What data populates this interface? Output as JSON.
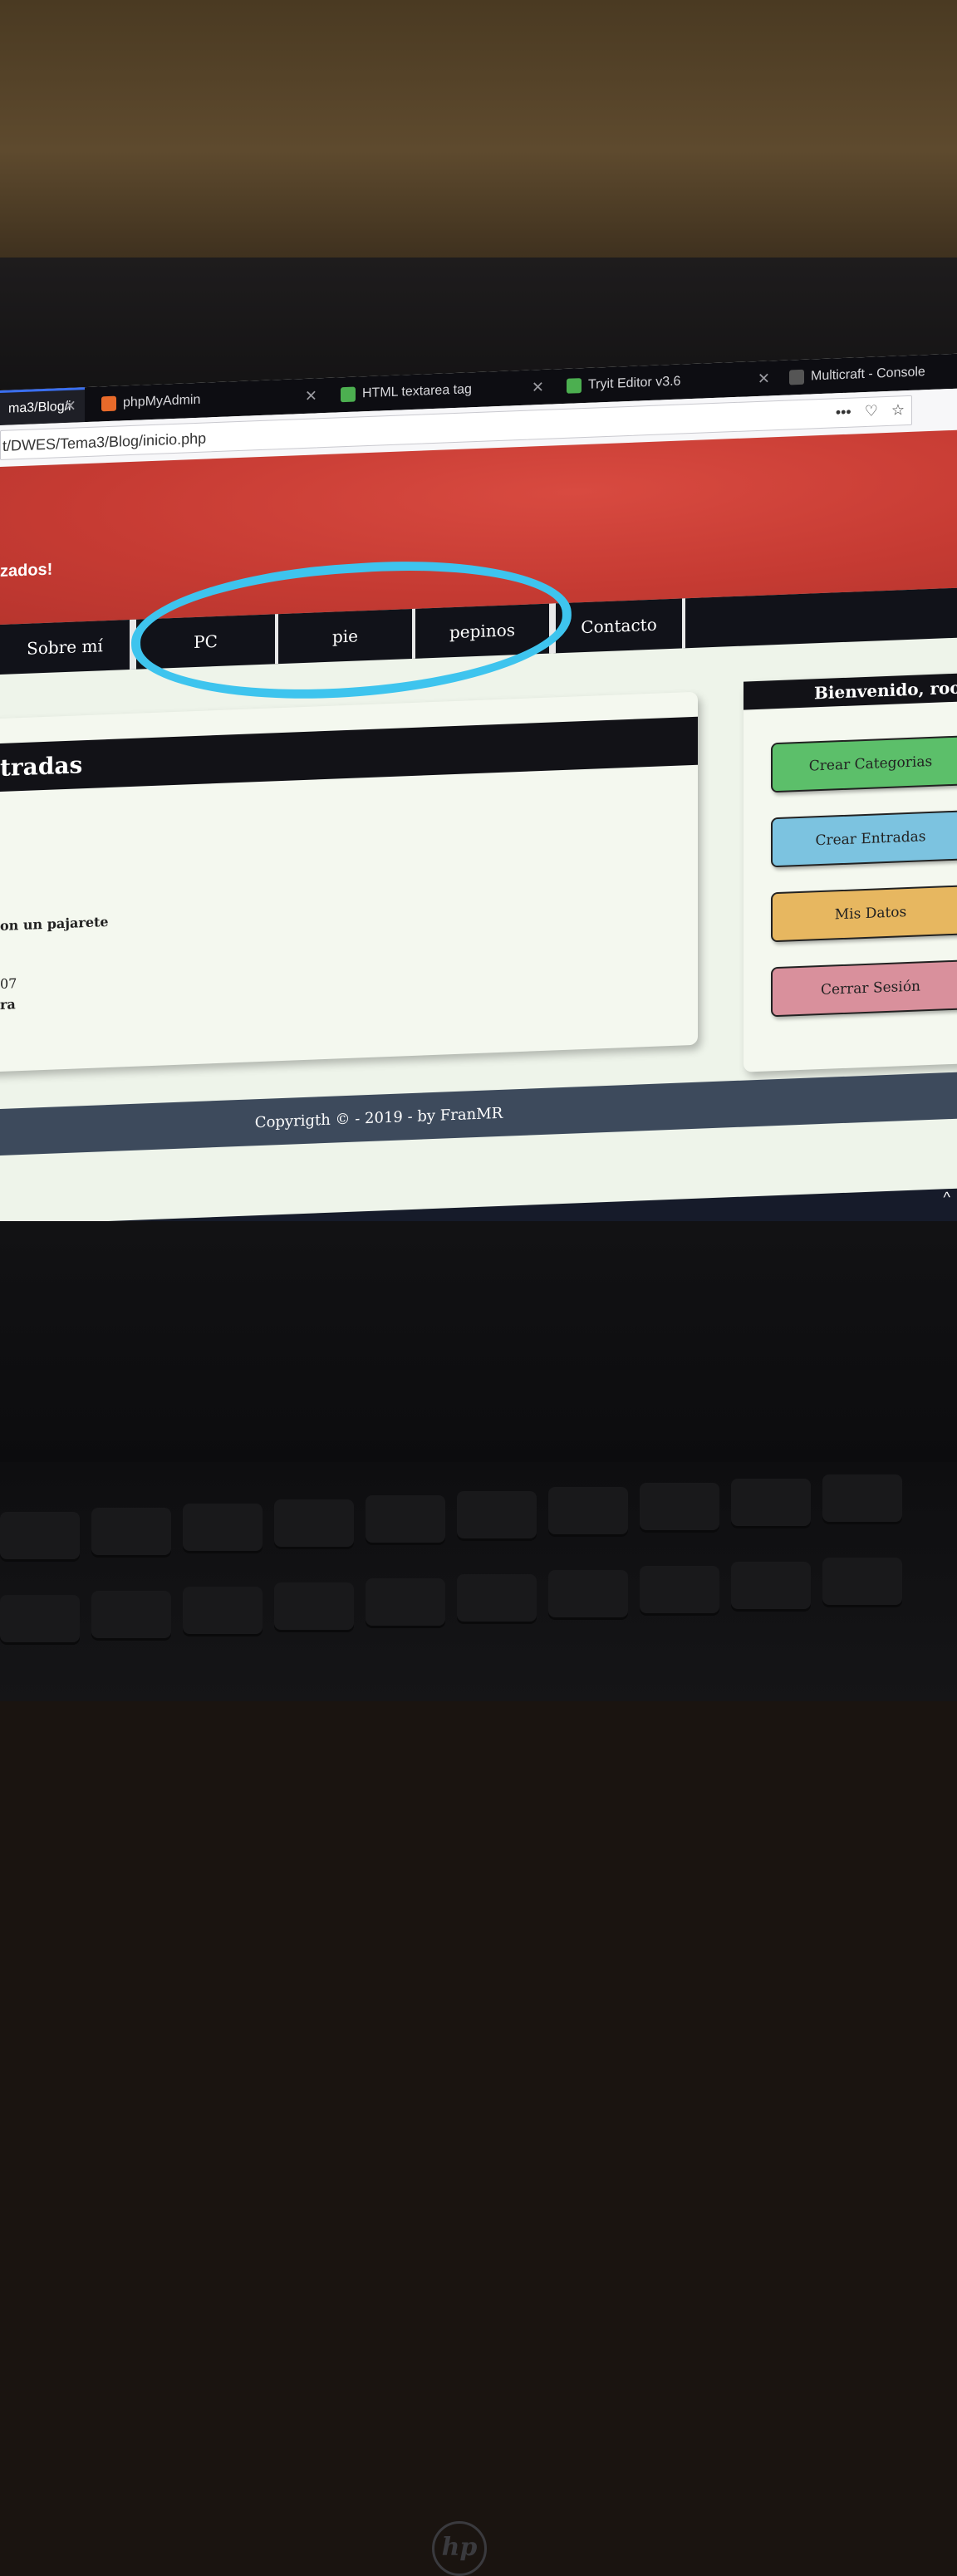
{
  "browser": {
    "tabs": [
      {
        "label": "ma3/Blog/i",
        "active": true
      },
      {
        "label": "phpMyAdmin",
        "active": false
      },
      {
        "label": "HTML textarea tag",
        "active": false
      },
      {
        "label": "Tryit Editor v3.6",
        "active": false
      },
      {
        "label": "Multicraft - Console",
        "active": false
      }
    ],
    "close_glyph": "✕",
    "url": "t/DWES/Tema3/Blog/inicio.php",
    "menu_glyph": "•••",
    "pocket_glyph": "♡",
    "star_glyph": "☆"
  },
  "site": {
    "header_text": "zados!",
    "nav": [
      "Sobre mí",
      "PC",
      "pie",
      "pepinos",
      "Contacto"
    ],
    "main": {
      "title": "tradas",
      "lines": [
        "on un pajarete",
        "07",
        "ra"
      ]
    },
    "sidebar": {
      "welcome": "Bienvenido, root",
      "buttons": [
        {
          "label": "Crear Categorias",
          "color": "#5cbf6a"
        },
        {
          "label": "Crear Entradas",
          "color": "#7cc3e0"
        },
        {
          "label": "Mis Datos",
          "color": "#e7b760"
        },
        {
          "label": "Cerrar Sesión",
          "color": "#d9909c"
        }
      ]
    },
    "footer": "Copyrigth © - 2019 - by FranMR"
  },
  "annotation": {
    "color": "#3ec4ee"
  },
  "taskbar": {
    "up_glyph": "^"
  },
  "laptop": {
    "brand": "hp"
  }
}
